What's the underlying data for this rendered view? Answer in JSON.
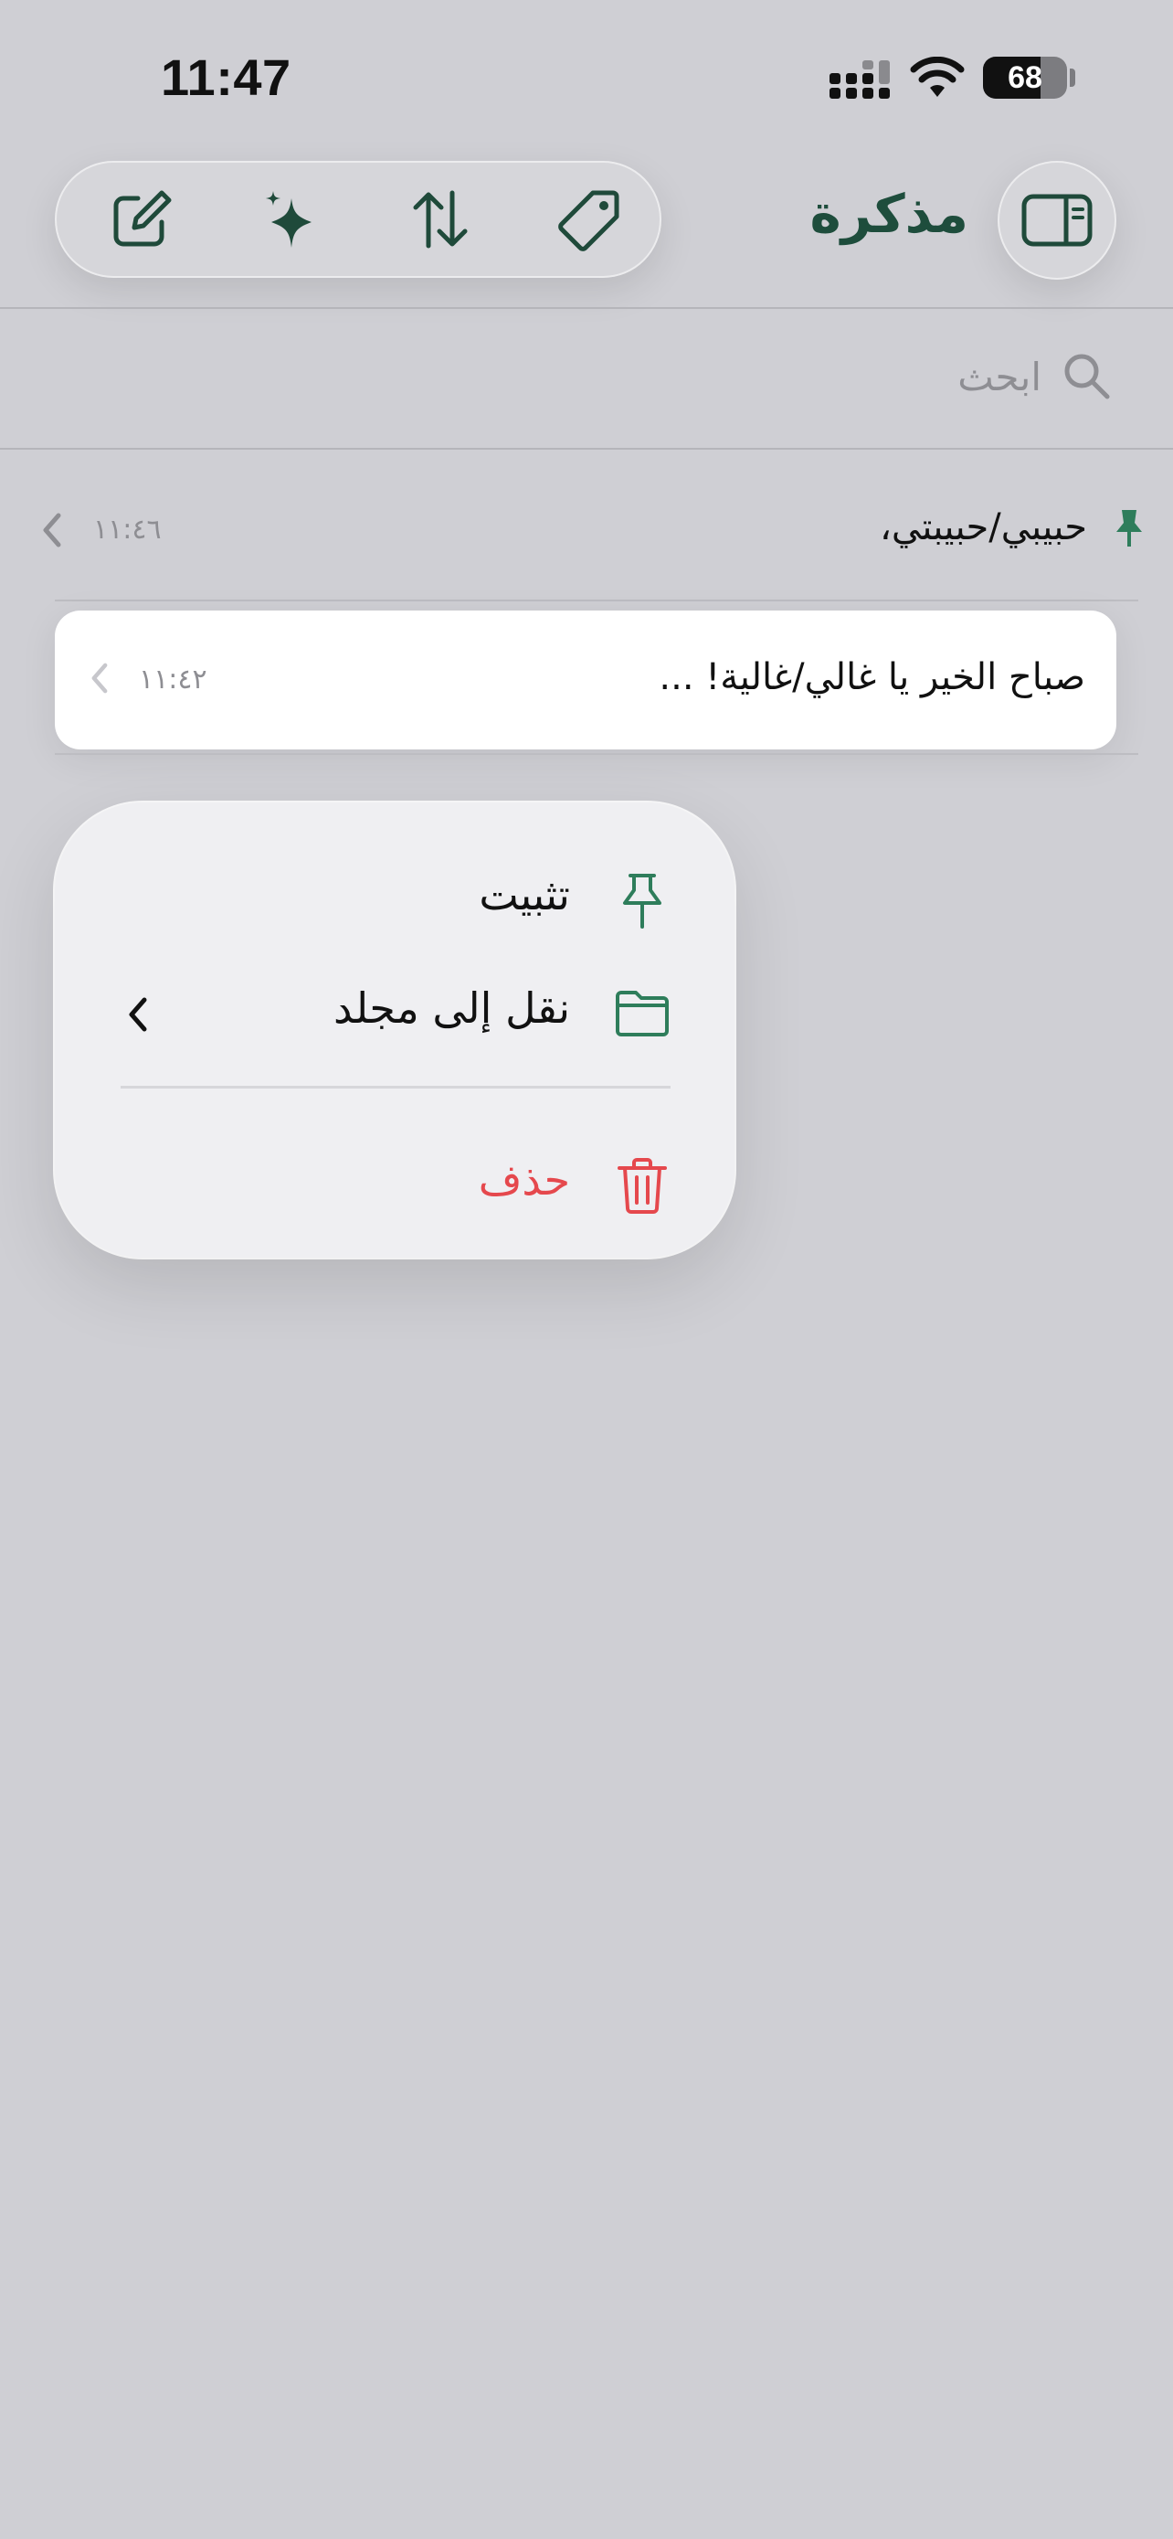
{
  "status_bar": {
    "time": "11:47",
    "battery": "68",
    "battery_level": 0.68
  },
  "toolbar": {
    "compose_icon": "compose-icon",
    "sparkle_icon": "sparkle-icon",
    "sort_icon": "sort-icon",
    "tag_icon": "tag-icon"
  },
  "header": {
    "title": "مذكرة",
    "sidebar_icon": "sidebar-toggle-icon"
  },
  "search": {
    "placeholder": "ابحث"
  },
  "notes": [
    {
      "title": "حبيبي/حبيبتي،",
      "time": "١١:٤٦",
      "pinned": true
    },
    {
      "title": "صباح الخير يا غالي/غالية! ...",
      "time": "١١:٤٢",
      "pinned": false
    }
  ],
  "context_menu": {
    "pin": "تثبيت",
    "move_to_folder": "نقل إلى مجلد",
    "delete": "حذف"
  },
  "colors": {
    "background": "#cfcfd4",
    "accent": "#2e7d5b",
    "title": "#1e4d3c",
    "delete": "#e5484d",
    "secondary_text": "#8e8e93"
  }
}
